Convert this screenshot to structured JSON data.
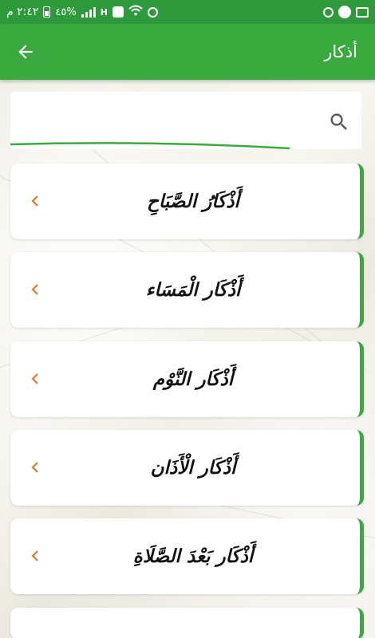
{
  "status_bar": {
    "time": "٢:٤٢ م",
    "battery": "٤٥%",
    "signal_letter": "H"
  },
  "app_bar": {
    "title": "أذكار",
    "back_icon": "arrow-left-icon"
  },
  "search": {
    "placeholder": "",
    "icon": "search-icon"
  },
  "list": {
    "items": [
      {
        "label": "أَذْكَارُ الصَّبَاحِ"
      },
      {
        "label": "أَذْكَار الْمَسَاء"
      },
      {
        "label": "أَذْكَار النَّوْم"
      },
      {
        "label": "أَذْكَار الْأَذَان"
      },
      {
        "label": "أَذْكَار بَعْدَ الصَّلَاةِ"
      }
    ]
  },
  "colors": {
    "status_bar": "#2e9a3c",
    "app_bar": "#3aaa3f",
    "accent_border": "#3aaa3f",
    "chevron": "#e07b2c"
  }
}
